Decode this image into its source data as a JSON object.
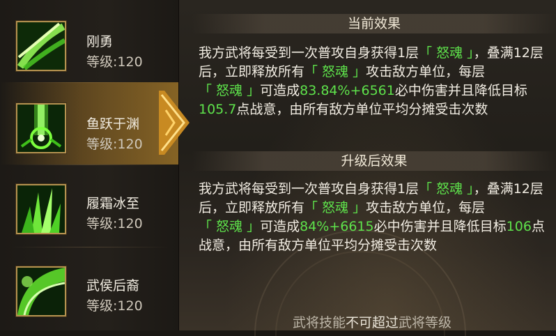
{
  "skills": [
    {
      "name": "刚勇",
      "level": "等级:120",
      "icon": "green-swirl-icon",
      "selected": false
    },
    {
      "name": "鱼跃于渊",
      "level": "等级:120",
      "icon": "green-beam-icon",
      "selected": true
    },
    {
      "name": "履霜冰至",
      "level": "等级:120",
      "icon": "green-ice-burst-icon",
      "selected": false
    },
    {
      "name": "武侯后裔",
      "level": "等级:120",
      "icon": "green-fan-icon",
      "selected": false
    }
  ],
  "current": {
    "title": "当前效果",
    "p1": "我方武将每受到一次普攻自身获得1层",
    "kw1": "「 怒魂 」",
    "p2": "，叠满12层后，立即释放所有",
    "kw2": "「 怒魂 」",
    "p3": "攻击敌方单位，每层",
    "kw3": "「 怒魂 」",
    "p4": "可造成",
    "v1": "83.84%+6561",
    "p5": "必中伤害并且降低目标",
    "v2": "105.7",
    "p6": "点战意，由所有敌方单位平均分摊受击次数"
  },
  "upgrade": {
    "title": "升级后效果",
    "p1": "我方武将每受到一次普攻自身获得1层",
    "kw1": "「 怒魂 」",
    "p2": "，叠满12层后，立即释放所有",
    "kw2": "「 怒魂 」",
    "p3": "攻击敌方单位，每层",
    "kw3": "「 怒魂 」",
    "p4": "可造成",
    "v1": "84%+6615",
    "p5": "必中伤害并且降低目标",
    "v2": "106",
    "p6": "点战意，由所有敌方单位平均分摊受击次数"
  },
  "footer": {
    "a": "武将技能",
    "b": "不可超过",
    "c": "武将等级"
  },
  "colors": {
    "highlight": "#5ee24b",
    "accent_gold": "#d9a53a",
    "text": "#f2ede3"
  }
}
